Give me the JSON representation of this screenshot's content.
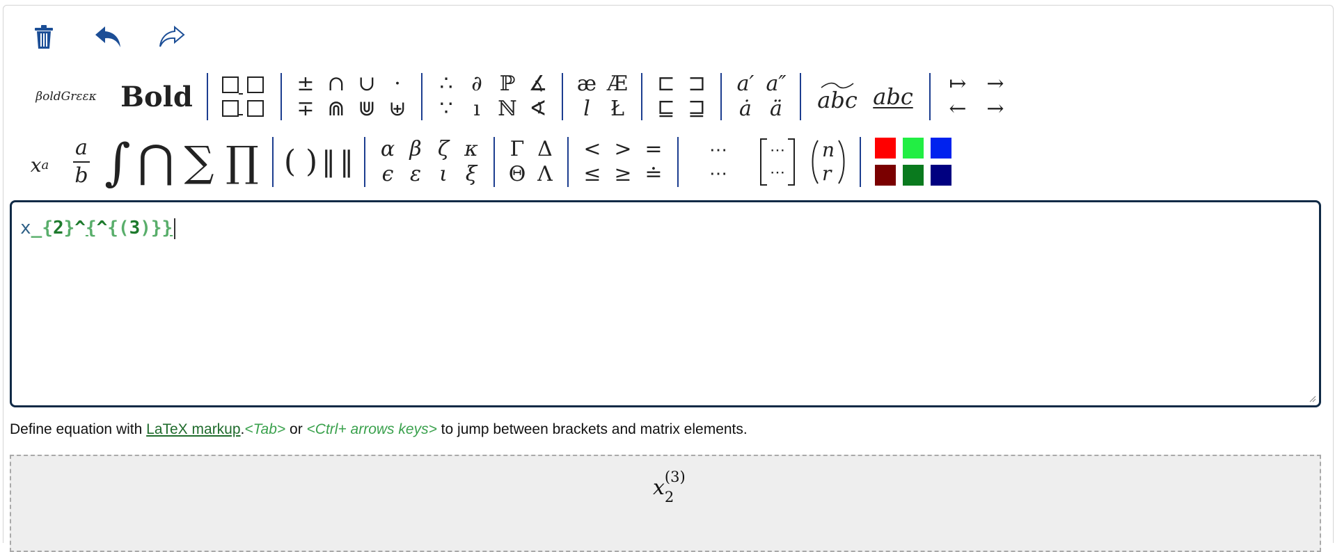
{
  "toolbar_top": {
    "icons": [
      "trash-icon",
      "undo-icon",
      "redo-icon"
    ],
    "accent": "#1c4e96"
  },
  "row1": {
    "bold_greek": "βoldGrεεκ",
    "bold": "Bold",
    "symbols": [
      [
        "±",
        "∩",
        "∪",
        "·"
      ],
      [
        "∓",
        "⋒",
        "⋓",
        "⊎"
      ]
    ],
    "logic": [
      [
        "∴",
        "∂",
        "ℙ",
        "∡"
      ],
      [
        "∵",
        "ı",
        "ℕ",
        "∢"
      ]
    ],
    "letters": [
      [
        "æ",
        "Æ"
      ],
      [
        "l",
        "Ł"
      ]
    ],
    "subsets": [
      [
        "⊏",
        "⊐"
      ],
      [
        "⊑",
        "⊒"
      ]
    ],
    "accents": [
      [
        "a′",
        "a″"
      ],
      [
        "ȧ",
        "ä"
      ]
    ],
    "wide": [
      "abc",
      "abc"
    ],
    "arrows": [
      [
        "↦",
        "→"
      ],
      [
        "←",
        "→"
      ]
    ]
  },
  "row2": {
    "superscript": {
      "base": "x",
      "exp": "a"
    },
    "fraction": {
      "num": "a",
      "den": "b"
    },
    "big_ops": [
      "∫",
      "⋂",
      "∑",
      "∏"
    ],
    "delims": [
      "( )",
      "‖",
      "‖"
    ],
    "greek_lower": [
      [
        "α",
        "β",
        "ζ",
        "κ"
      ],
      [
        "ϵ",
        "ε",
        "ι",
        "ξ"
      ]
    ],
    "greek_upper": [
      [
        "Γ",
        "Δ"
      ],
      [
        "Θ",
        "Λ"
      ]
    ],
    "relations": [
      [
        "<",
        ">",
        "="
      ],
      [
        "≤",
        "≥",
        "≐"
      ]
    ],
    "dots": [
      "⋯",
      "⋯"
    ],
    "matrix": [
      "⋯",
      "⋯"
    ],
    "binom": {
      "top": "n",
      "bottom": "r"
    },
    "colors": [
      "#ff0000",
      "#22ee44",
      "#0022ee",
      "#7a0000",
      "#0a7a1e",
      "#000080"
    ]
  },
  "editor": {
    "tokens": [
      "x",
      "_",
      "{",
      "2",
      "}",
      "^",
      "{",
      "^",
      "{",
      "(",
      "3",
      ")",
      "}",
      "}"
    ]
  },
  "help": {
    "prefix": "Define equation with ",
    "link": "LaTeX markup",
    "dot": ".",
    "tab": "<Tab>",
    "or": " or ",
    "ctrl": "<Ctrl+ arrows keys>",
    "suffix": " to jump between brackets and matrix elements."
  },
  "preview": {
    "base": "x",
    "sub": "2",
    "sup": "(3)"
  }
}
